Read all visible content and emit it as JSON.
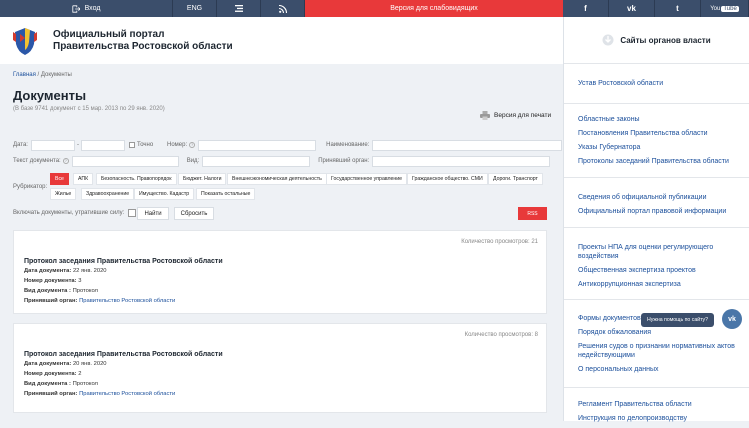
{
  "topbar": {
    "login": "Вход",
    "eng": "ENG",
    "low_vision": "Версия для слабовидящих",
    "facebook": "f",
    "vk": "vk",
    "twitter": "t",
    "youtube_you": "You",
    "youtube_tube": "Tube"
  },
  "header": {
    "title_line1": "Официальный портал",
    "title_line2": "Правительства Ростовской области"
  },
  "breadcrumb": {
    "home": "Главная",
    "sep": "/",
    "current": "Документы"
  },
  "page": {
    "title": "Документы",
    "subtitle": "(В базе 9741 документ с 15 мар. 2013 по 29 янв. 2020)",
    "print": "Версия для печати"
  },
  "filters": {
    "date_label": "Дата:",
    "exact": "Точно",
    "number_label": "Номер:",
    "name_label": "Наименование:",
    "text_label": "Текст документа:",
    "type_label": "Вид:",
    "org_label": "Принявший орган:",
    "rubricator_label": "Рубрикатор:",
    "tags": [
      "Все",
      "АПК",
      "Безопасность. Правопорядок",
      "Бюджет. Налоги",
      "Внешнеэкономическая деятельность",
      "Государственное управление",
      "Гражданское общество. СМИ",
      "Дороги. Транспорт",
      "Жилье",
      "Здравоохранение",
      "Имущество. Кадастр",
      "Показать остальные"
    ],
    "include_invalid": "Включать документы, утратившие силу:",
    "find": "Найти",
    "reset": "Сбросить",
    "rss": "RSS"
  },
  "documents": [
    {
      "views": "Количество просмотров: 21",
      "title": "Протокол заседания Правительства Ростовской области",
      "date_label": "Дата документа:",
      "date": "22 янв. 2020",
      "num_label": "Номер документа:",
      "num": "3",
      "type_label": "Вид документа :",
      "type": "Протокол",
      "org_label": "Принявший орган:",
      "org": "Правительство Ростовской области"
    },
    {
      "views": "Количество просмотров: 8",
      "title": "Протокол заседания Правительства Ростовской области",
      "date_label": "Дата документа:",
      "date": "20 янв. 2020",
      "num_label": "Номер документа:",
      "num": "2",
      "type_label": "Вид документа :",
      "type": "Протокол",
      "org_label": "Принявший орган:",
      "org": "Правительство Ростовской области"
    }
  ],
  "sidebar": {
    "title": "Сайты органов власти",
    "group1": [
      "Устав Ростовской области"
    ],
    "group2": [
      "Областные законы",
      "Постановления Правительства области",
      "Указы Губернатора",
      "Протоколы заседаний Правительства области"
    ],
    "group3": [
      "Сведения об официальной публикации",
      "Официальный портал правовой информации"
    ],
    "group4": [
      "Проекты НПА для оценки регулирующего воздействия",
      "Общественная экспертиза проектов",
      "Антикоррупционная экспертиза"
    ],
    "group5": [
      "Формы документов (Бланки)",
      "Порядок обжалования",
      "Решения судов о признании нормативных актов недействующими",
      "О персональных данных"
    ],
    "group6": [
      "Регламент Правительства области",
      "Инструкция по делопроизводству"
    ]
  },
  "help": {
    "tooltip": "Нужна помощь по сайту?",
    "vk": "vk"
  },
  "colors": {
    "topbar": "#3b4e6b",
    "accent_red": "#e8393a",
    "link": "#1b4f9b"
  }
}
